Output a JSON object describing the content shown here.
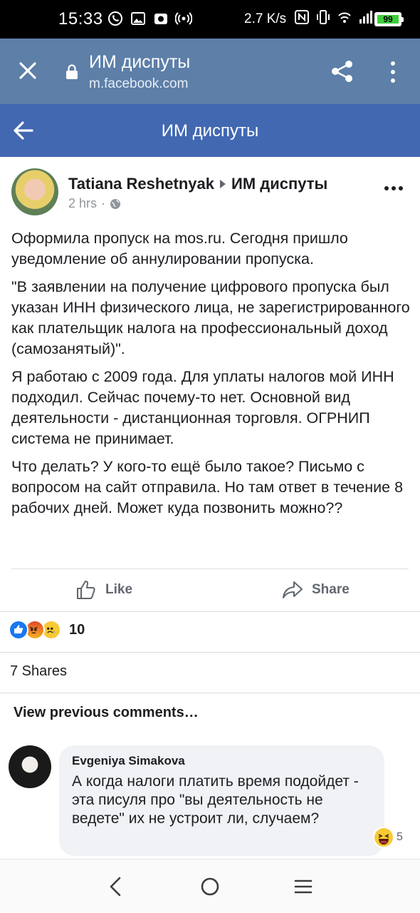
{
  "status_bar": {
    "time": "15:33",
    "net_speed": "2.7 K/s",
    "battery": "99"
  },
  "browser": {
    "title": "ИМ диспуты",
    "url": "m.facebook.com"
  },
  "page_header": {
    "title": "ИМ диспуты"
  },
  "post": {
    "author": "Tatiana Reshetnyak",
    "group": "ИМ диспуты",
    "time": "2 hrs",
    "paragraphs": [
      "Оформила пропуск на mos.ru. Сегодня пришло уведомление об аннулировании пропуска.",
      "\"В заявлении на получение цифрового пропуска был указан ИНН физического лица, не зарегистрированного как плательщик налога на профессиональный доход (самозанятый)\".",
      "Я работаю с 2009 года. Для уплаты налогов мой ИНН подходил. Сейчас почему-то нет. Основной вид деятельности - дистанционная торговля. ОГРНИП система не принимает.",
      "Что делать? У кого-то ещё было такое? Письмо с вопросом на сайт отправила. Но там ответ в течение 8 рабочих дней. Может куда позвонить можно??"
    ],
    "like_label": "Like",
    "share_label": "Share",
    "reaction_count": "10",
    "shares_text": "7 Shares",
    "view_previous": "View previous comments…"
  },
  "comment": {
    "author": "Evgeniya Simakova",
    "text": "А когда налоги платить время подойдет - эта писуля про \"вы деятельность не ведете\" их не устроит ли, случаем?",
    "reaction_count": "5"
  },
  "colors": {
    "browser_bar": "#5d7fa8",
    "page_header": "#4268b2",
    "like_blue": "#1877f2",
    "text_gray": "#606770"
  }
}
